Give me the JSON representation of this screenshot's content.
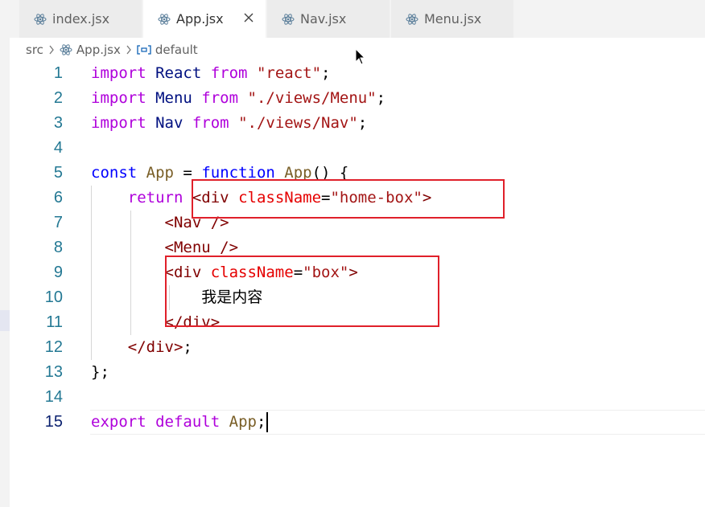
{
  "tabs": [
    {
      "label": "index.jsx",
      "icon": "react-icon",
      "active": false
    },
    {
      "label": "App.jsx",
      "icon": "react-icon",
      "active": true,
      "close": "×"
    },
    {
      "label": "Nav.jsx",
      "icon": "react-icon",
      "active": false
    },
    {
      "label": "Menu.jsx",
      "icon": "react-icon",
      "active": false
    }
  ],
  "breadcrumb": {
    "folder": "src",
    "file": "App.jsx",
    "symbol": "default"
  },
  "editor": {
    "current_line": 15,
    "lines": [
      {
        "num": "1",
        "tokens": [
          {
            "t": "import",
            "c": "kw"
          },
          {
            "t": " React ",
            "c": "id"
          },
          {
            "t": "from",
            "c": "kw"
          },
          {
            "t": " ",
            "c": "pl"
          },
          {
            "t": "\"react\"",
            "c": "str"
          },
          {
            "t": ";",
            "c": "pl"
          }
        ]
      },
      {
        "num": "2",
        "tokens": [
          {
            "t": "import",
            "c": "kw"
          },
          {
            "t": " Menu ",
            "c": "id"
          },
          {
            "t": "from",
            "c": "kw"
          },
          {
            "t": " ",
            "c": "pl"
          },
          {
            "t": "\"./views/Menu\"",
            "c": "str"
          },
          {
            "t": ";",
            "c": "pl"
          }
        ]
      },
      {
        "num": "3",
        "tokens": [
          {
            "t": "import",
            "c": "kw"
          },
          {
            "t": " Nav ",
            "c": "id"
          },
          {
            "t": "from",
            "c": "kw"
          },
          {
            "t": " ",
            "c": "pl"
          },
          {
            "t": "\"./views/Nav\"",
            "c": "str"
          },
          {
            "t": ";",
            "c": "pl"
          }
        ]
      },
      {
        "num": "4",
        "tokens": []
      },
      {
        "num": "5",
        "tokens": [
          {
            "t": "const",
            "c": "kw2"
          },
          {
            "t": " ",
            "c": "pl"
          },
          {
            "t": "App",
            "c": "fn"
          },
          {
            "t": " = ",
            "c": "pl"
          },
          {
            "t": "function",
            "c": "kw2"
          },
          {
            "t": " ",
            "c": "pl"
          },
          {
            "t": "App",
            "c": "fn"
          },
          {
            "t": "() {",
            "c": "pl"
          }
        ]
      },
      {
        "num": "6",
        "tokens": [
          {
            "t": "    ",
            "c": "pl"
          },
          {
            "t": "return",
            "c": "kw"
          },
          {
            "t": " ",
            "c": "pl"
          },
          {
            "t": "<div",
            "c": "tag"
          },
          {
            "t": " ",
            "c": "pl"
          },
          {
            "t": "className",
            "c": "attr"
          },
          {
            "t": "=",
            "c": "pl"
          },
          {
            "t": "\"home-box\"",
            "c": "str"
          },
          {
            "t": ">",
            "c": "tag"
          }
        ]
      },
      {
        "num": "7",
        "tokens": [
          {
            "t": "        ",
            "c": "pl"
          },
          {
            "t": "<Nav />",
            "c": "tag"
          }
        ]
      },
      {
        "num": "8",
        "tokens": [
          {
            "t": "        ",
            "c": "pl"
          },
          {
            "t": "<Menu />",
            "c": "tag"
          }
        ]
      },
      {
        "num": "9",
        "tokens": [
          {
            "t": "        ",
            "c": "pl"
          },
          {
            "t": "<div",
            "c": "tag"
          },
          {
            "t": " ",
            "c": "pl"
          },
          {
            "t": "className",
            "c": "attr"
          },
          {
            "t": "=",
            "c": "pl"
          },
          {
            "t": "\"box\"",
            "c": "str"
          },
          {
            "t": ">",
            "c": "tag"
          }
        ]
      },
      {
        "num": "10",
        "tokens": [
          {
            "t": "            ",
            "c": "pl"
          },
          {
            "t": "我是内容",
            "c": "cn"
          }
        ]
      },
      {
        "num": "11",
        "tokens": [
          {
            "t": "        ",
            "c": "pl"
          },
          {
            "t": "</div>",
            "c": "tag"
          }
        ]
      },
      {
        "num": "12",
        "tokens": [
          {
            "t": "    ",
            "c": "pl"
          },
          {
            "t": "</div>",
            "c": "tag"
          },
          {
            "t": ";",
            "c": "pl"
          }
        ]
      },
      {
        "num": "13",
        "tokens": [
          {
            "t": "};",
            "c": "pl"
          }
        ]
      },
      {
        "num": "14",
        "tokens": []
      },
      {
        "num": "15",
        "tokens": [
          {
            "t": "export",
            "c": "kw"
          },
          {
            "t": " ",
            "c": "pl"
          },
          {
            "t": "default",
            "c": "kw"
          },
          {
            "t": " ",
            "c": "pl"
          },
          {
            "t": "App",
            "c": "fn"
          },
          {
            "t": ";",
            "c": "pl"
          }
        ]
      }
    ]
  },
  "colors": {
    "keyword": "#af00db",
    "storage": "#0000ff",
    "identifier": "#001080",
    "string": "#a31515",
    "tag": "#800000",
    "attribute": "#e50000",
    "function": "#795e26",
    "line_number": "#237893",
    "highlight_box": "#e0202a"
  }
}
